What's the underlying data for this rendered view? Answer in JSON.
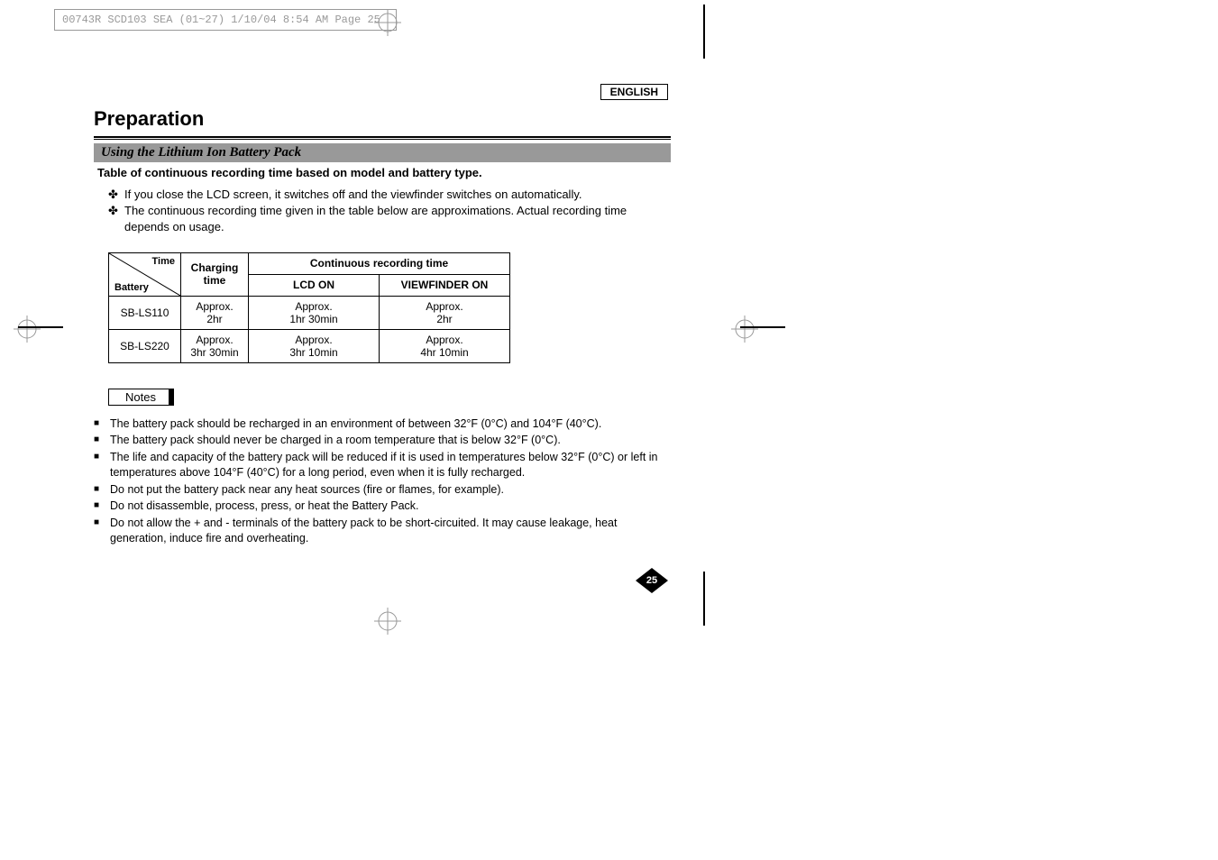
{
  "header_info": "00743R SCD103 SEA (01~27)  1/10/04 8:54 AM  Page 25",
  "language": "ENGLISH",
  "main_title": "Preparation",
  "section_header": "Using the Lithium Ion Battery Pack",
  "subtitle": "Table of continuous recording time based on model and battery type.",
  "bullets": [
    "If you close the LCD screen, it switches off and the viewfinder switches on automatically.",
    "The continuous recording time given in the table below are approximations. Actual recording time depends on usage."
  ],
  "table": {
    "diag_top": "Time",
    "diag_bottom": "Battery",
    "charging_header": "Charging time",
    "continuous_header": "Continuous recording time",
    "lcd_header": "LCD ON",
    "vf_header": "VIEWFINDER ON",
    "rows": [
      {
        "battery": "SB-LS110",
        "charge_l1": "Approx.",
        "charge_l2": "2hr",
        "lcd_l1": "Approx.",
        "lcd_l2": "1hr 30min",
        "vf_l1": "Approx.",
        "vf_l2": "2hr"
      },
      {
        "battery": "SB-LS220",
        "charge_l1": "Approx.",
        "charge_l2": "3hr 30min",
        "lcd_l1": "Approx.",
        "lcd_l2": "3hr 10min",
        "vf_l1": "Approx.",
        "vf_l2": "4hr 10min"
      }
    ]
  },
  "notes_label": "Notes",
  "notes": [
    "The battery pack should be recharged in an environment of between 32°F (0°C) and 104°F (40°C).",
    "The battery pack should never be charged in a room temperature that is below 32°F (0°C).",
    "The life and capacity of the battery pack will be reduced if it is used in temperatures below 32°F (0°C) or left in temperatures above 104°F (40°C) for a long period, even when it is fully recharged.",
    "Do not put the battery pack near any heat sources (fire or flames, for example).",
    "Do not disassemble, process, press, or heat the Battery Pack.",
    "Do not allow the + and - terminals of the battery pack to be short-circuited. It may cause leakage, heat generation, induce fire and overheating."
  ],
  "page_number": "25"
}
